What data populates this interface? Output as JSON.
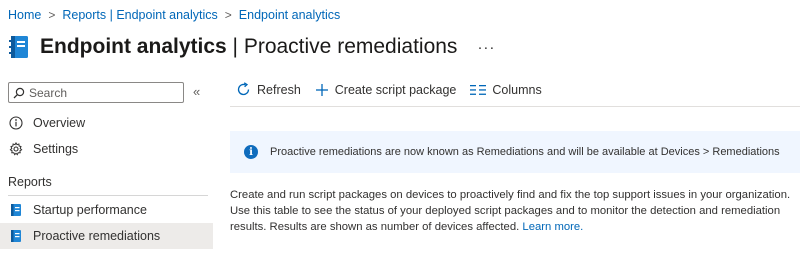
{
  "breadcrumb": [
    {
      "label": "Home"
    },
    {
      "label": "Reports | Endpoint analytics"
    },
    {
      "label": "Endpoint analytics"
    }
  ],
  "header": {
    "title_main": "Endpoint analytics",
    "title_separator": " | ",
    "title_sub": "Proactive remediations",
    "more_label": "···"
  },
  "sidebar": {
    "search_placeholder": "Search",
    "collapse_icon": "«",
    "items": [
      {
        "label": "Overview",
        "icon": "info-circle-icon"
      },
      {
        "label": "Settings",
        "icon": "gear-icon"
      }
    ],
    "section_label": "Reports",
    "report_items": [
      {
        "label": "Startup performance",
        "icon": "report-icon",
        "selected": false
      },
      {
        "label": "Proactive remediations",
        "icon": "report-icon",
        "selected": true
      }
    ]
  },
  "toolbar": {
    "refresh_label": "Refresh",
    "create_label": "Create script package",
    "columns_label": "Columns"
  },
  "info_banner": {
    "text": "Proactive remediations are now known as Remediations and will be available at Devices > Remediations"
  },
  "description": {
    "text": "Create and run script packages on devices to proactively find and fix the top support issues in your organization. Use this table to see the status of your deployed script packages and to monitor the detection and remediation results. Results are shown as number of devices affected. ",
    "link": "Learn more."
  },
  "colors": {
    "accent": "#0067b8",
    "info_bg": "#f0f6ff",
    "selected_bg": "#edebe9"
  }
}
